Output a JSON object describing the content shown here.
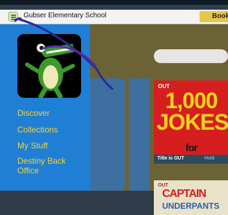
{
  "header": {
    "menu_icon": "hamburger-menu-icon",
    "school_name": "Gubser Elementary School",
    "tab_label": "Book"
  },
  "sidebar": {
    "logo_icon": "alligator-mascot-icon",
    "items": [
      {
        "label": "Discover"
      },
      {
        "label": "Collections"
      },
      {
        "label": "My Stuff"
      },
      {
        "label": "Destiny Back Office"
      }
    ]
  },
  "books": [
    {
      "badge": "OUT",
      "cover_title": "1,000 JOKES",
      "cover_subtitle": "for",
      "status": "Title is OUT",
      "action": "Hold"
    },
    {
      "badge": "OUT",
      "cover_title": "CAPTAIN",
      "cover_subtitle": "UNDERPANTS"
    }
  ],
  "colors": {
    "sidebar": "#1f7fd4",
    "nav_text": "#f3d23b",
    "annotation": "#2a2a9a"
  }
}
